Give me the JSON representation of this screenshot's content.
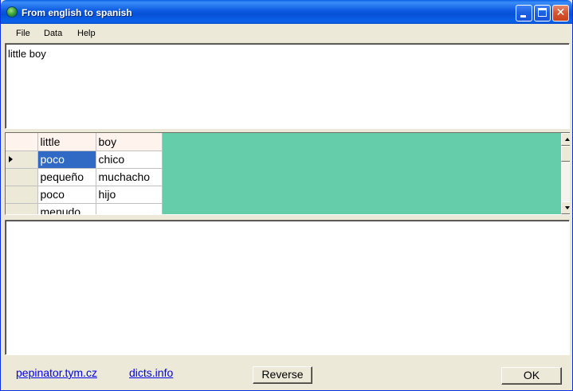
{
  "window": {
    "title": "From english to spanish"
  },
  "menu": {
    "items": [
      "File",
      "Data",
      "Help"
    ]
  },
  "input": {
    "value": "little boy"
  },
  "grid": {
    "headers": [
      "little",
      "boy"
    ],
    "rows": [
      [
        "poco",
        "chico"
      ],
      [
        "pequeño",
        "muchacho"
      ],
      [
        "poco",
        "hijo"
      ],
      [
        "menudo",
        ""
      ]
    ],
    "selected_row": 0,
    "background_color": "#66CDAA",
    "selection_color": "#316AC5"
  },
  "output": {
    "value": ""
  },
  "footer": {
    "link1": "pepinator.tym.cz",
    "link2": "dicts.info",
    "reverse_label": "Reverse",
    "ok_label": "OK"
  },
  "icons": {
    "app": "globe-icon",
    "row_indicator": "arrow-right-icon"
  }
}
